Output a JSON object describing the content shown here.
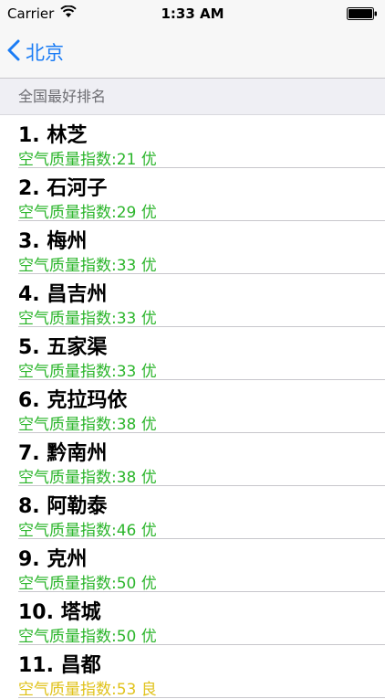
{
  "status_bar": {
    "carrier": "Carrier",
    "time": "1:33 AM"
  },
  "nav": {
    "back_label": "北京"
  },
  "section": {
    "title": "全国最好排名"
  },
  "rankings": [
    {
      "label": "1. 林芝",
      "aqi": "空气质量指数:21 优"
    },
    {
      "label": "2. 石河子",
      "aqi": "空气质量指数:29 优"
    },
    {
      "label": "3. 梅州",
      "aqi": "空气质量指数:33 优"
    },
    {
      "label": "4. 昌吉州",
      "aqi": "空气质量指数:33 优"
    },
    {
      "label": "5. 五家渠",
      "aqi": "空气质量指数:33 优"
    },
    {
      "label": "6. 克拉玛依",
      "aqi": "空气质量指数:38 优"
    },
    {
      "label": "7. 黔南州",
      "aqi": "空气质量指数:38 优"
    },
    {
      "label": "8. 阿勒泰",
      "aqi": "空气质量指数:46 优"
    },
    {
      "label": "9. 克州",
      "aqi": "空气质量指数:50 优"
    },
    {
      "label": "10. 塔城",
      "aqi": "空气质量指数:50 优"
    },
    {
      "label": "11. 昌都",
      "aqi": "空气质量指数:53 良"
    }
  ],
  "colors": {
    "good": "#2bb52b",
    "moderate": "#e0c21a",
    "accent": "#1a7cf5"
  }
}
